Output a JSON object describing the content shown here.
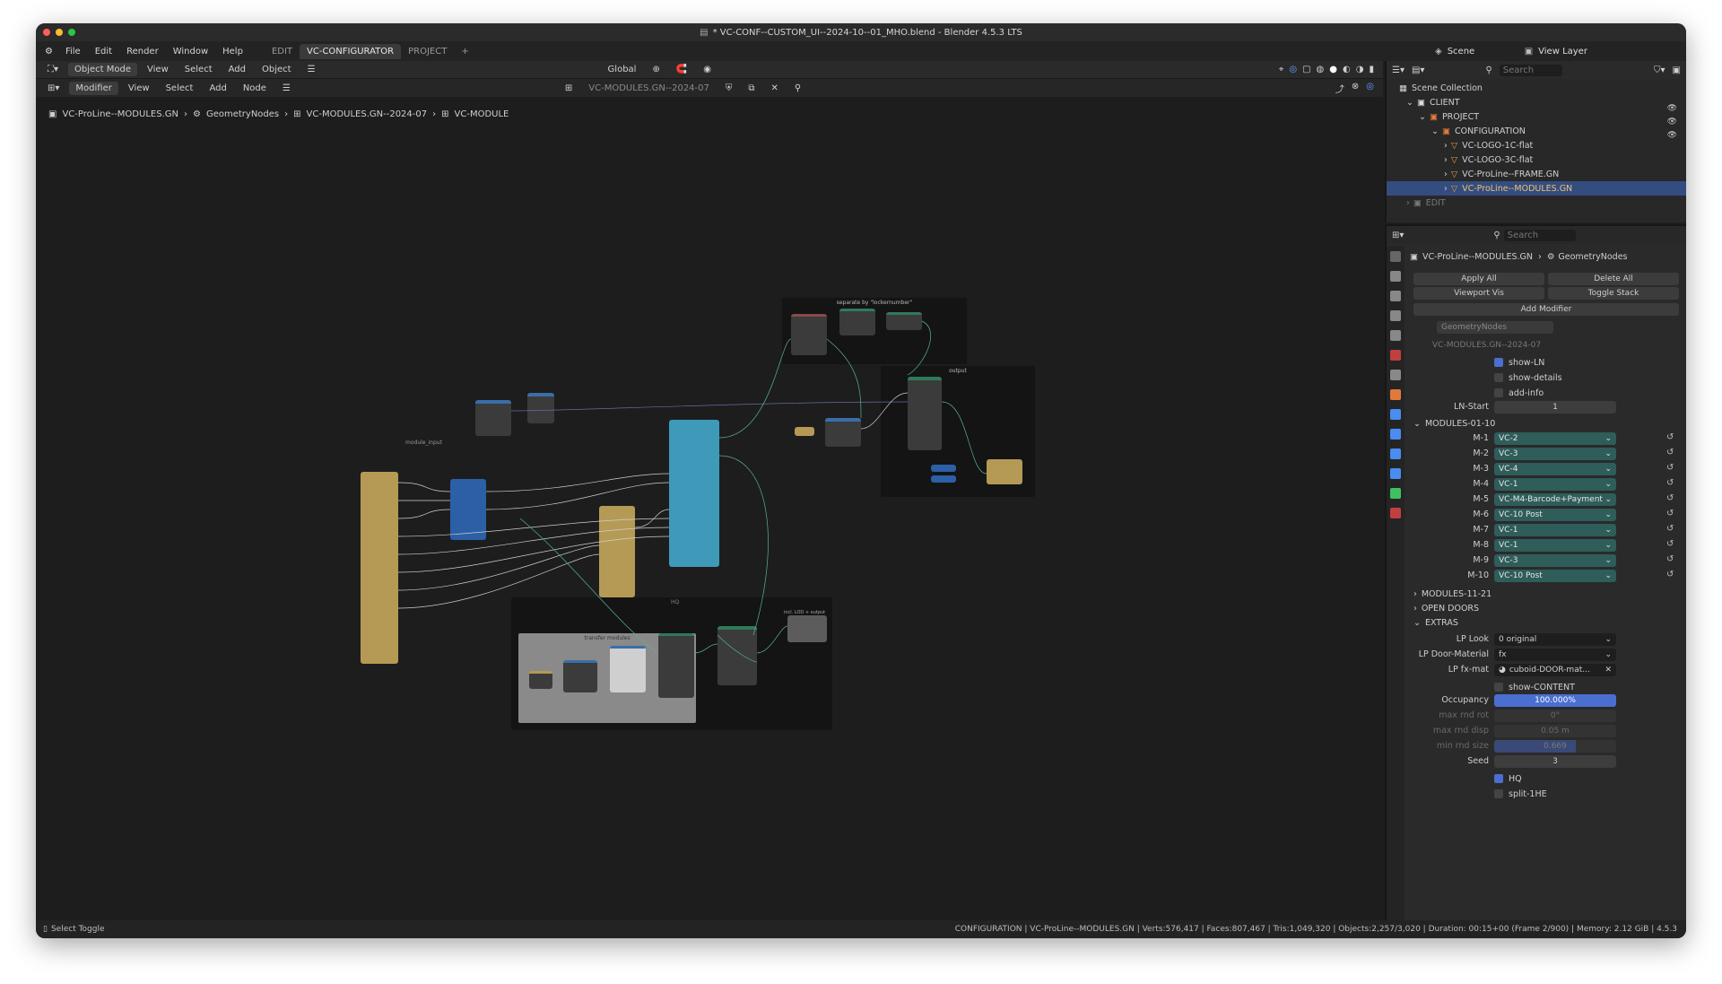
{
  "window": {
    "title": "* VC-CONF--CUSTOM_UI--2024-10--01_MHO.blend - Blender 4.5.3 LTS"
  },
  "menu": {
    "items": [
      "File",
      "Edit",
      "Render",
      "Window",
      "Help"
    ]
  },
  "workspaces": {
    "tabs": [
      "EDIT",
      "VC-CONFIGURATOR",
      "PROJECT"
    ],
    "active": "VC-CONFIGURATOR",
    "add": "+"
  },
  "scene": {
    "label": "Scene",
    "view_layer": "View Layer"
  },
  "header3d": {
    "mode": "Object Mode",
    "menus": [
      "View",
      "Select",
      "Add",
      "Object"
    ],
    "transform": "Global"
  },
  "node_header": {
    "editor": "Modifier",
    "menus": [
      "View",
      "Select",
      "Add",
      "Node"
    ],
    "nodegroup": "VC-MODULES.GN--2024-07"
  },
  "breadcrumb": {
    "items": [
      "VC-ProLine--MODULES.GN",
      "GeometryNodes",
      "VC-MODULES.GN--2024-07",
      "VC-MODULE"
    ]
  },
  "frames": {
    "separate": "separate by \"lockernumber\"",
    "output": "output",
    "transfer": "transfer modules",
    "module_input": "module_input",
    "hq": "HQ",
    "lod": "incl. LOD + output"
  },
  "outliner": {
    "search_placeholder": "Search",
    "root": "Scene Collection",
    "items": [
      {
        "label": "CLIENT",
        "depth": 1
      },
      {
        "label": "PROJECT",
        "depth": 2
      },
      {
        "label": "CONFIGURATION",
        "depth": 3
      },
      {
        "label": "VC-LOGO-1C-flat",
        "depth": 4
      },
      {
        "label": "VC-LOGO-3C-flat",
        "depth": 4
      },
      {
        "label": "VC-ProLine--FRAME.GN",
        "depth": 4
      },
      {
        "label": "VC-ProLine--MODULES.GN",
        "depth": 4,
        "selected": true
      },
      {
        "label": "EDIT",
        "depth": 1
      }
    ]
  },
  "properties": {
    "search_placeholder": "Search",
    "object": "VC-ProLine--MODULES.GN",
    "modifier_path": "GeometryNodes",
    "apply_all": "Apply All",
    "delete_all": "Delete All",
    "viewport_vis": "Viewport Vis",
    "toggle_stack": "Toggle Stack",
    "add_modifier": "Add Modifier",
    "modifier_name": "GeometryNodes",
    "nodegroup": "VC-MODULES.GN--2024-07",
    "show_ln": "show-LN",
    "show_details": "show-details",
    "add_info": "add-info",
    "ln_start_label": "LN-Start",
    "ln_start_value": "1",
    "panel_modules_1": "MODULES-01-10",
    "modules": [
      {
        "label": "M-1",
        "value": "VC-2"
      },
      {
        "label": "M-2",
        "value": "VC-3"
      },
      {
        "label": "M-3",
        "value": "VC-4"
      },
      {
        "label": "M-4",
        "value": "VC-1"
      },
      {
        "label": "M-5",
        "value": "VC-M4-Barcode+Payment"
      },
      {
        "label": "M-6",
        "value": "VC-10 Post"
      },
      {
        "label": "M-7",
        "value": "VC-1"
      },
      {
        "label": "M-8",
        "value": "VC-1"
      },
      {
        "label": "M-9",
        "value": "VC-3"
      },
      {
        "label": "M-10",
        "value": "VC-10 Post"
      }
    ],
    "panel_modules_2": "MODULES-11-21",
    "panel_open_doors": "OPEN DOORS",
    "panel_extras": "EXTRAS",
    "lp_look_label": "LP Look",
    "lp_look_value": "0 original",
    "lp_door_label": "LP Door-Material",
    "lp_door_value": "fx",
    "lp_fx_label": "LP fx-mat",
    "lp_fx_value": "cuboid-DOOR-mat...",
    "show_content": "show-CONTENT",
    "occupancy_label": "Occupancy",
    "occupancy_value": "100.000%",
    "max_rnd_rot_label": "max rnd rot",
    "max_rnd_rot_value": "0°",
    "max_rnd_disp_label": "max rnd disp",
    "max_rnd_disp_value": "0.05 m",
    "min_rnd_size_label": "min rnd size",
    "min_rnd_size_value": "0.669",
    "seed_label": "Seed",
    "seed_value": "3",
    "hq": "HQ",
    "split": "split-1HE"
  },
  "status": {
    "left": "Select Toggle",
    "right": "CONFIGURATION | VC-ProLine--MODULES.GN | Verts:576,417 | Faces:807,467 | Tris:1,049,320 | Objects:2,257/3,020 | Duration: 00:15+00 (Frame 2/900) | Memory: 2.12 GiB | 4.5.3"
  },
  "colors": {
    "accent": "#4a6fd0",
    "teal": "#2e5d5a",
    "selected": "#334d80",
    "node_yellow": "#b59a55",
    "node_blue": "#2b5fa6",
    "node_cyan": "#3e9ab8"
  }
}
